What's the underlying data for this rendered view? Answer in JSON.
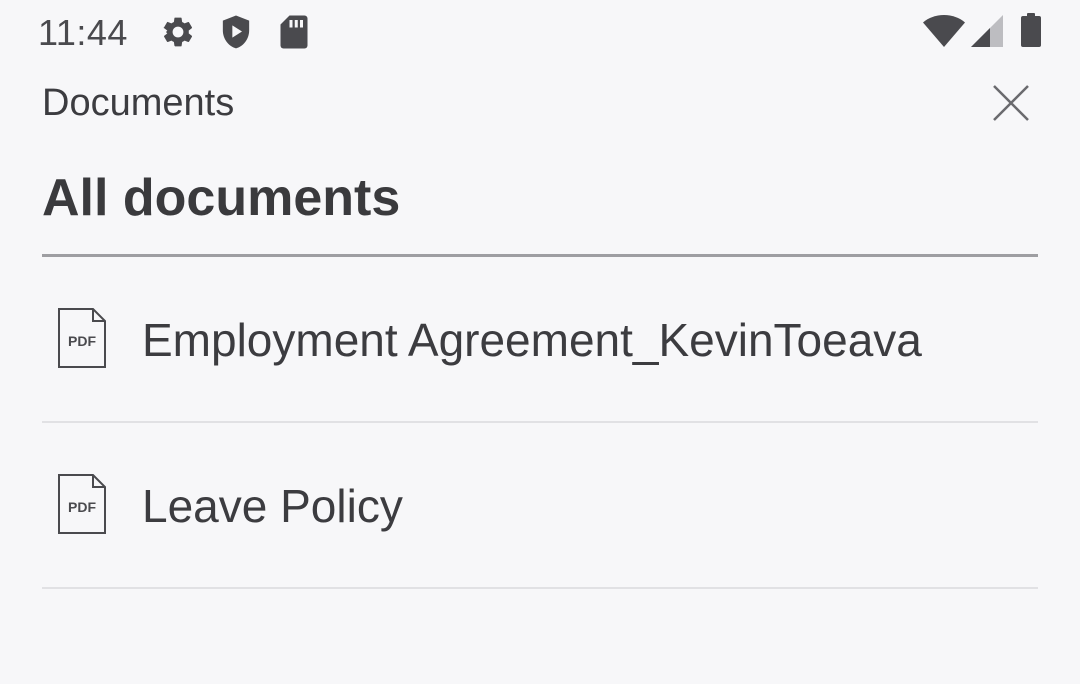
{
  "status_bar": {
    "time": "11:44",
    "left_icons": [
      "gear-icon",
      "shield-play-icon",
      "sd-card-icon"
    ],
    "right_icons": [
      "wifi-icon",
      "cell-signal-icon",
      "battery-icon"
    ]
  },
  "header": {
    "title": "Documents",
    "close_icon": "close-icon"
  },
  "section": {
    "title": "All documents"
  },
  "documents": [
    {
      "icon": "pdf-file-icon",
      "icon_label": "PDF",
      "name": "Employment Agreement_KevinToeava"
    },
    {
      "icon": "pdf-file-icon",
      "icon_label": "PDF",
      "name": "Leave Policy"
    }
  ],
  "colors": {
    "background": "#f7f7f9",
    "text": "#3a3a3d",
    "divider_strong": "#9e9ea2",
    "divider_light": "#e1e1e4"
  }
}
